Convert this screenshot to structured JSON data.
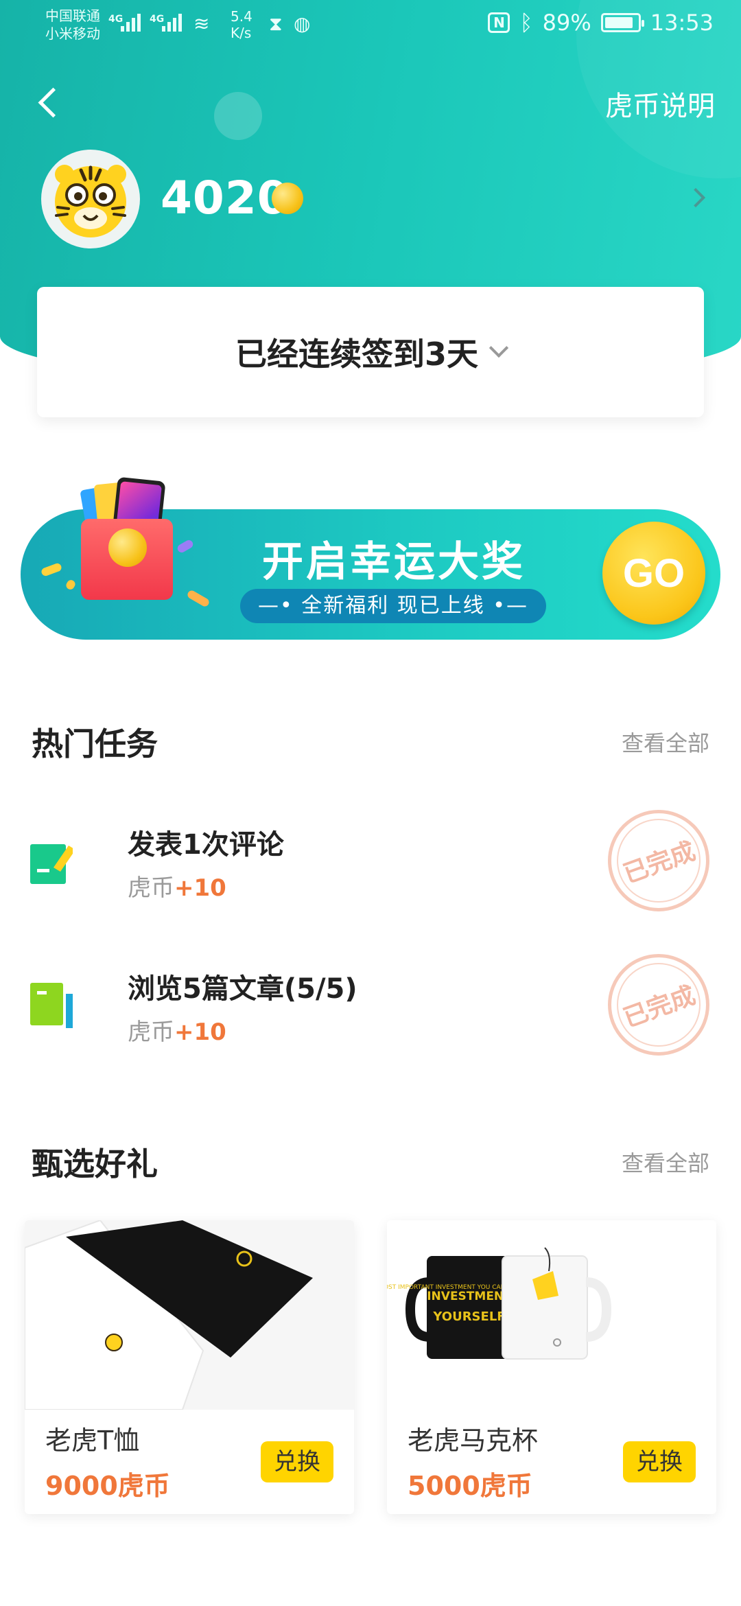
{
  "status_bar": {
    "carrier1": "中国联通",
    "carrier2": "小米移动",
    "net1": "4G",
    "net2": "4G",
    "speed_value": "5.4",
    "speed_unit": "K/s",
    "nfc": "N",
    "battery": "89%",
    "time": "13:53"
  },
  "nav": {
    "explain_link": "虎币说明"
  },
  "profile": {
    "coin_count": "4020"
  },
  "checkin": {
    "text": "已经连续签到3天"
  },
  "banner": {
    "title": "开启幸运大奖",
    "subtitle": "—• 全新福利 现已上线 •—",
    "go_label": "GO"
  },
  "hot_tasks": {
    "title": "热门任务",
    "view_all": "查看全部",
    "items": [
      {
        "title": "发表1次评论",
        "reward_label": "虎币",
        "reward_value": "+10",
        "status": "已完成",
        "icon": "edit-note-icon"
      },
      {
        "title": "浏览5篇文章(5/5)",
        "reward_label": "虎币",
        "reward_value": "+10",
        "status": "已完成",
        "icon": "book-icon"
      }
    ]
  },
  "gifts": {
    "title": "甄选好礼",
    "view_all": "查看全部",
    "items": [
      {
        "name": "老虎T恤",
        "price": "9000虎币",
        "button": "兑换"
      },
      {
        "name": "老虎马克杯",
        "price": "5000虎币",
        "button": "兑换"
      }
    ],
    "mug_text": "THE MOST IMPORTANT INVESTMENT YOU CAN MAKE IS IN YOURSELF"
  },
  "colors": {
    "header_start": "#16b3a8",
    "header_end": "#29d7c6",
    "accent_orange": "#f0773a",
    "button_yellow": "#ffd400"
  }
}
